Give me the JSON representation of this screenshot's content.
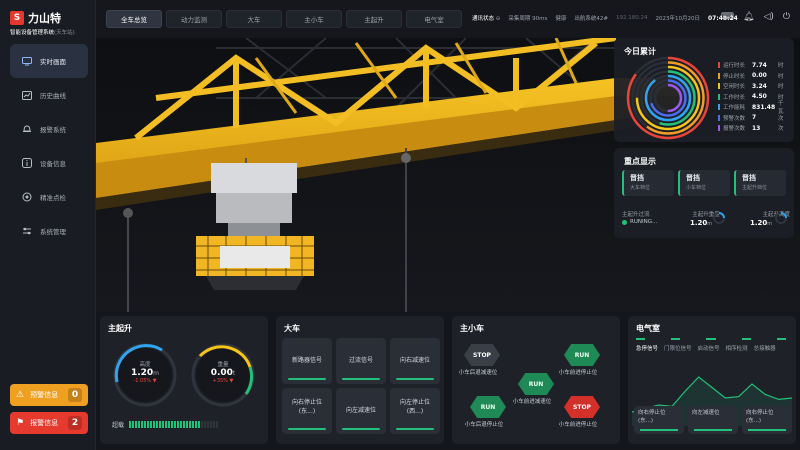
{
  "app": {
    "logo_letter": "S",
    "name": "力山特",
    "subtitle": "智能设备管理系统",
    "subtitle_suffix": "(天车站)"
  },
  "sidebar": {
    "items": [
      {
        "label": "实时画面",
        "icon": "monitor-icon",
        "active": true
      },
      {
        "label": "历史曲线",
        "icon": "chart-icon",
        "active": false
      },
      {
        "label": "报警系统",
        "icon": "bell-icon",
        "active": false
      },
      {
        "label": "设备信息",
        "icon": "info-icon",
        "active": false
      },
      {
        "label": "精准点检",
        "icon": "target-icon",
        "active": false
      },
      {
        "label": "系统管理",
        "icon": "sliders-icon",
        "active": false
      }
    ],
    "warning": {
      "label": "预警信息",
      "count": "0"
    },
    "alarm": {
      "label": "报警信息",
      "count": "2"
    }
  },
  "tabs": [
    {
      "label": "全车总览",
      "active": true
    },
    {
      "label": "动力监测",
      "active": false
    },
    {
      "label": "大车",
      "active": false
    },
    {
      "label": "主小车",
      "active": false
    },
    {
      "label": "主起升",
      "active": false
    },
    {
      "label": "电气室",
      "active": false
    }
  ],
  "status_bar": {
    "comm_label": "通讯状态",
    "sample_label": "采集周期",
    "sample_value": "90ms",
    "health_label": "健康",
    "device_label": "出航系统42#",
    "ip": "192.180.24",
    "date": "2023年10月20日",
    "time": "07:48:24"
  },
  "today_stats": {
    "title": "今日累计",
    "rows": [
      {
        "label": "运行时长",
        "value": "7.74",
        "unit": "时",
        "color": "#e9453a"
      },
      {
        "label": "停止时长",
        "value": "0.00",
        "unit": "时",
        "color": "#f39c26"
      },
      {
        "label": "空闲时长",
        "value": "3.24",
        "unit": "时",
        "color": "#f5c518"
      },
      {
        "label": "工作时长",
        "value": "4.50",
        "unit": "时",
        "color": "#22c07a"
      },
      {
        "label": "工作能耗",
        "value": "831.48",
        "unit": "千瓦",
        "color": "#2fa4f0"
      },
      {
        "label": "预警次数",
        "value": "7",
        "unit": "次",
        "color": "#4a6cf7"
      },
      {
        "label": "报警次数",
        "value": "13",
        "unit": "次",
        "color": "#9b59f0"
      }
    ],
    "ring_fractions": [
      0.85,
      0.6,
      0.75,
      0.55,
      0.9,
      0.7,
      0.5
    ]
  },
  "key_display": {
    "title": "重点显示",
    "cards": [
      {
        "value": "晋挡",
        "label": "大车档位"
      },
      {
        "value": "晋挡",
        "label": "小车档位"
      },
      {
        "value": "晋挡",
        "label": "主起升档位"
      }
    ],
    "labels": [
      "主起升过流",
      "主起升重量",
      "主起升高度"
    ],
    "running_text": "RUNING...",
    "weight_value": "1.20",
    "weight_unit": "m",
    "height_value": "1.20",
    "height_unit": "m"
  },
  "main_hoist": {
    "title": "主起升",
    "height": {
      "label": "高度",
      "value": "1.20",
      "unit": "m",
      "delta": "-1.05% ▼"
    },
    "weight": {
      "label": "重量",
      "value": "0.00",
      "unit": "t",
      "delta": "+35% ▼"
    },
    "speed_label": "超载",
    "speed_level": 0.8
  },
  "big_car": {
    "title": "大车",
    "signals": [
      {
        "line1": "新路器信号",
        "line2": ""
      },
      {
        "line1": "过流信号",
        "line2": ""
      },
      {
        "line1": "向右减速位",
        "line2": ""
      },
      {
        "line1": "向右停止位",
        "line2": "(东...)"
      },
      {
        "line1": "向左减速位",
        "line2": ""
      },
      {
        "line1": "向左停止位",
        "line2": "(西...)"
      }
    ]
  },
  "trolley": {
    "title": "主小车",
    "buttons": [
      {
        "text": "STOP",
        "label": "小车后退减速位",
        "style": "stop-dark"
      },
      {
        "text": "RUN",
        "label": "小车前进停止位",
        "style": "run"
      },
      {
        "text": "RUN",
        "label": "小车前进减速位",
        "style": "run"
      },
      {
        "text": "RUN",
        "label": "小车后退停止位",
        "style": "run"
      },
      {
        "text": "STOP",
        "label": "小车前进停止位",
        "style": "stop-red"
      }
    ]
  },
  "electric": {
    "title": "电气室",
    "legend": [
      "急停信号",
      "门限位信号",
      "启动信号",
      "相序检测",
      "总接触器"
    ],
    "buttons": [
      {
        "line1": "向右停止位",
        "line2": "(东...)"
      },
      {
        "line1": "向左减速位",
        "line2": ""
      },
      {
        "line1": "向右停止位",
        "line2": "(东...)"
      }
    ],
    "wave": [
      0.2,
      0.25,
      0.3,
      0.28,
      0.5,
      0.7,
      0.55,
      0.4,
      0.42,
      0.6,
      0.45,
      0.38,
      0.4
    ]
  }
}
